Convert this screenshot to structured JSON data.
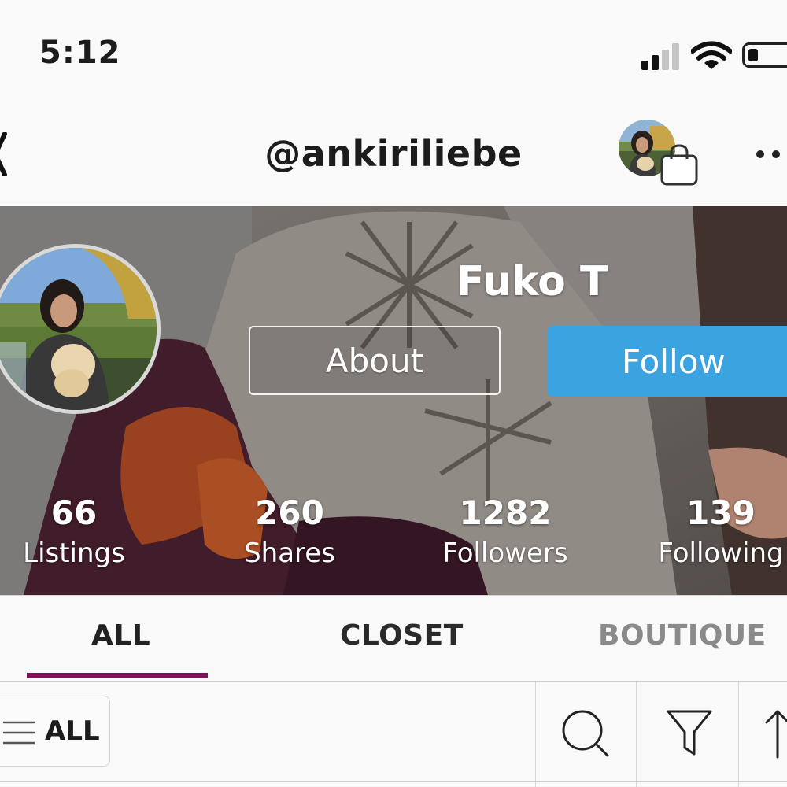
{
  "status_bar": {
    "time": "5:12"
  },
  "header": {
    "username": "@ankiriliebe"
  },
  "profile": {
    "display_name": "Fuko T",
    "about_label": "About",
    "follow_label": "Follow"
  },
  "stats": [
    {
      "value": "66",
      "label": "Listings"
    },
    {
      "value": "260",
      "label": "Shares"
    },
    {
      "value": "1282",
      "label": "Followers"
    },
    {
      "value": "139",
      "label": "Following"
    }
  ],
  "tabs": [
    {
      "label": "ALL",
      "active": true
    },
    {
      "label": "CLOSET",
      "active": false
    },
    {
      "label": "BOUTIQUE",
      "active": false
    }
  ],
  "toolbar": {
    "filter_label": "ALL"
  },
  "colors": {
    "accent": "#3ba3e0",
    "tab_indicator": "#7b1357",
    "inactive_tab": "#8a8a8a"
  },
  "icons": [
    "signal-icon",
    "wifi-icon",
    "battery-icon",
    "back-icon",
    "shopping-bag-icon",
    "more-icon",
    "menu-icon",
    "search-icon",
    "filter-icon",
    "sort-icon"
  ]
}
